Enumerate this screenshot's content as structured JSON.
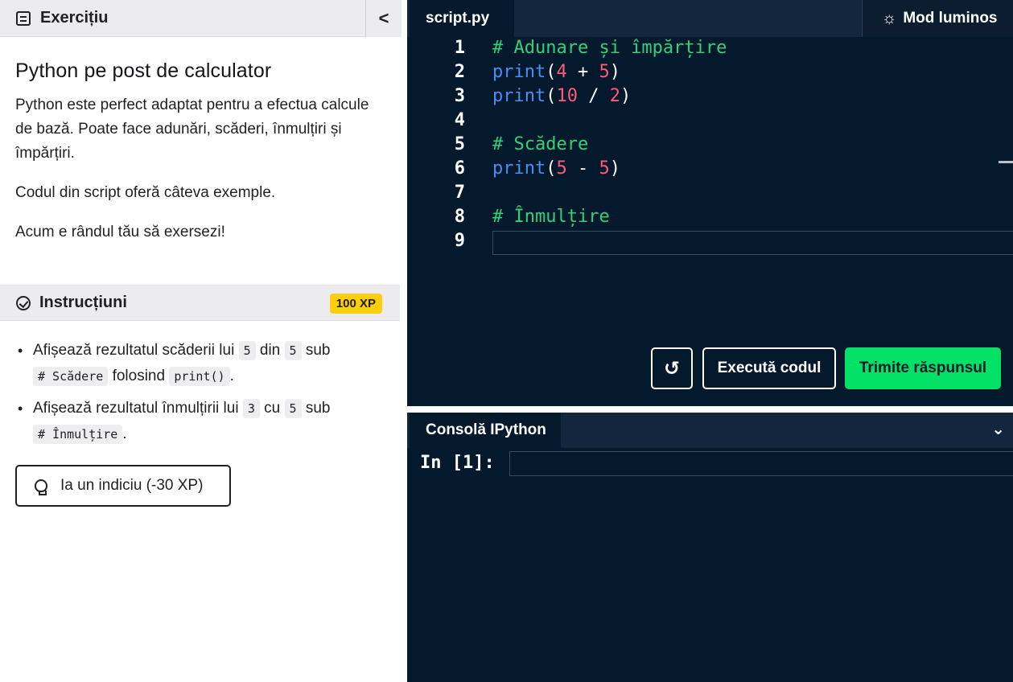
{
  "left_panel": {
    "exercise_header": "Exercițiu",
    "collapse_label": "<",
    "title": "Python pe post de calculator",
    "paragraphs": [
      "Python este perfect adaptat pentru a efectua calcule de bază. Poate face adunări, scăderi, înmulțiri și împărțiri.",
      "Codul din script oferă câteva exemple.",
      "Acum e rândul tău să exersezi!"
    ],
    "instructions_header": "Instrucțiuni",
    "xp_badge": "100 XP",
    "bullets": [
      {
        "t1": "Afișează rezultatul scăderii lui",
        "c1": "5",
        "t2": "din",
        "c2": "5",
        "t3": "sub",
        "c3": "# Scădere",
        "t4": "folosind",
        "c4": "print()",
        "t5": "."
      },
      {
        "t1": "Afișează rezultatul înmulțirii lui",
        "c1": "3",
        "t2": "cu",
        "c2": "5",
        "t3": "sub",
        "c3": "# Înmulțire",
        "t4": "."
      }
    ],
    "hint_button": "Ia un indiciu (-30 XP)"
  },
  "editor": {
    "tab_label": "script.py",
    "mode_button": "Mod luminos",
    "lines": [
      {
        "n": "1",
        "parts": [
          {
            "c": "cmt",
            "t": "# Adunare și împărțire"
          }
        ]
      },
      {
        "n": "2",
        "parts": [
          {
            "c": "kw",
            "t": "print"
          },
          {
            "c": "op",
            "t": "("
          },
          {
            "c": "num",
            "t": "4"
          },
          {
            "c": "op",
            "t": " + "
          },
          {
            "c": "num",
            "t": "5"
          },
          {
            "c": "op",
            "t": ")"
          }
        ]
      },
      {
        "n": "3",
        "parts": [
          {
            "c": "kw",
            "t": "print"
          },
          {
            "c": "op",
            "t": "("
          },
          {
            "c": "num",
            "t": "10"
          },
          {
            "c": "op",
            "t": " / "
          },
          {
            "c": "num",
            "t": "2"
          },
          {
            "c": "op",
            "t": ")"
          }
        ]
      },
      {
        "n": "4",
        "parts": []
      },
      {
        "n": "5",
        "parts": [
          {
            "c": "cmt",
            "t": "# Scădere"
          }
        ]
      },
      {
        "n": "6",
        "parts": [
          {
            "c": "kw",
            "t": "print"
          },
          {
            "c": "op",
            "t": "("
          },
          {
            "c": "num",
            "t": "5"
          },
          {
            "c": "op",
            "t": " - "
          },
          {
            "c": "num",
            "t": "5"
          },
          {
            "c": "op",
            "t": ")"
          }
        ]
      },
      {
        "n": "7",
        "parts": []
      },
      {
        "n": "8",
        "parts": [
          {
            "c": "cmt",
            "t": "# Înmulțire"
          }
        ]
      },
      {
        "n": "9",
        "parts": []
      }
    ],
    "run_button": "Execută codul",
    "submit_button": "Trimite răspunsul"
  },
  "console": {
    "tab_label": "Consolă IPython",
    "prompt": "In [1]:"
  },
  "colors": {
    "editor_bg": "#05192d",
    "submit_green": "#04e167",
    "xp_yellow": "#fcce0d",
    "comment_green": "#33d07a",
    "keyword_blue": "#4d8df0",
    "number_pink": "#ff5a7a"
  }
}
